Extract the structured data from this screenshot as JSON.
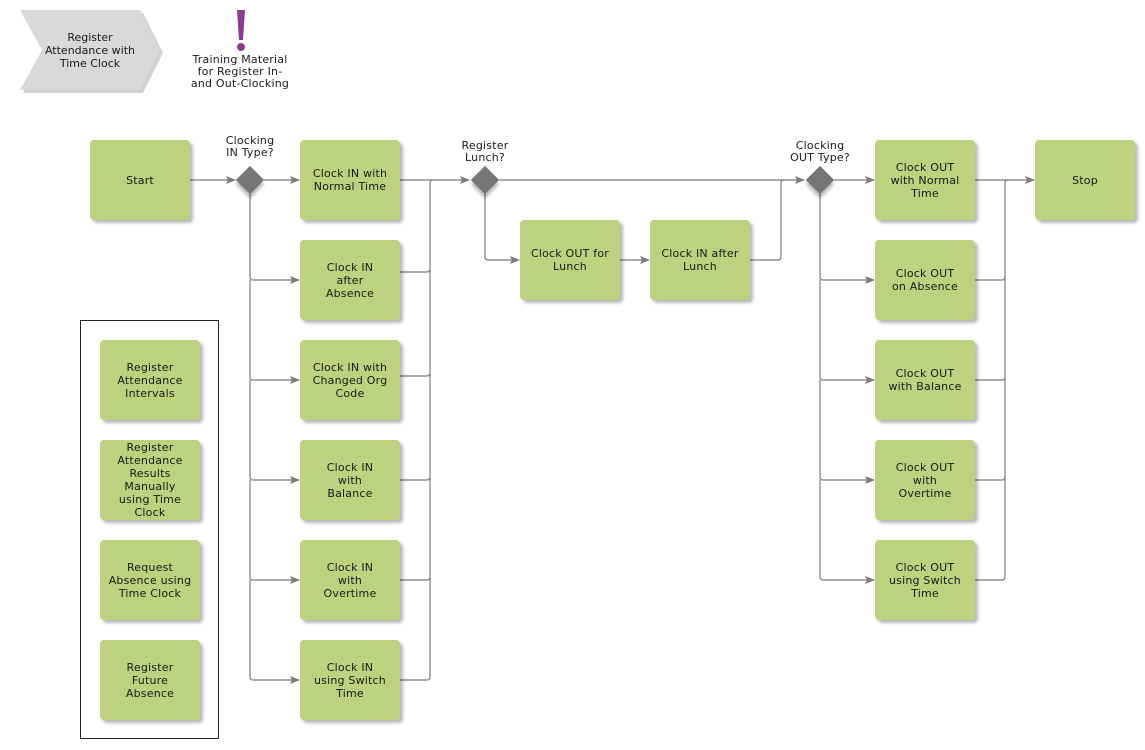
{
  "header": {
    "process_title": "Register\nAttendance with\nTime Clock",
    "training_note": "Training Material\nfor Register In-\nand Out-Clocking",
    "note_icon": "exclamation-icon",
    "colors": {
      "activity": "#bcd27f",
      "gateway": "#767676",
      "process_shape": "#d9d9d9",
      "note_icon": "#8b3a8f",
      "connector": "#7a7a7a"
    }
  },
  "flow": {
    "start": "Start",
    "stop": "Stop",
    "gateways": {
      "clocking_in": "Clocking\nIN Type?",
      "register_lunch": "Register\nLunch?",
      "clocking_out": "Clocking\nOUT Type?"
    },
    "clock_in": [
      "Clock IN with\nNormal Time",
      "Clock IN\nafter\nAbsence",
      "Clock IN with\nChanged Org\nCode",
      "Clock IN\nwith\nBalance",
      "Clock IN\nwith\nOvertime",
      "Clock IN\nusing Switch\nTime"
    ],
    "lunch": [
      "Clock OUT for\nLunch",
      "Clock IN after\nLunch"
    ],
    "clock_out": [
      "Clock OUT\nwith Normal\nTime",
      "Clock OUT\non Absence",
      "Clock OUT\nwith Balance",
      "Clock OUT\nwith\nOvertime",
      "Clock OUT\nusing Switch\nTime"
    ]
  },
  "related_processes": [
    "Register\nAttendance\nIntervals",
    "Register\nAttendance\nResults Manually\nusing Time Clock",
    "Request\nAbsence using\nTime Clock",
    "Register\nFuture\nAbsence"
  ]
}
